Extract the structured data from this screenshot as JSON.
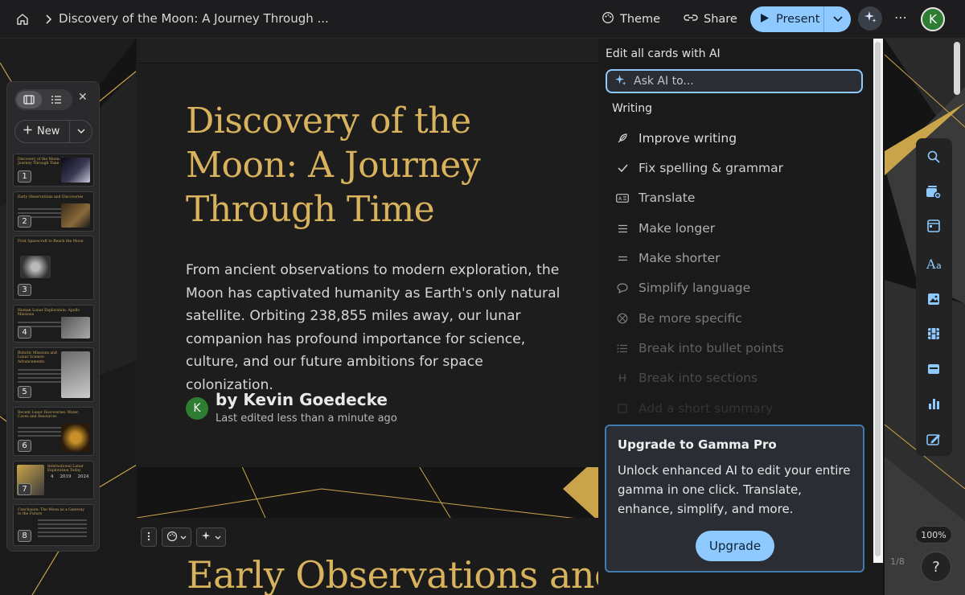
{
  "topbar": {
    "title": "Discovery of the Moon: A Journey Through ...",
    "theme_label": "Theme",
    "share_label": "Share",
    "present_label": "Present",
    "avatar_letter": "K",
    "more_label": "⋯"
  },
  "slides_panel": {
    "new_label": "New",
    "close_label": "✕",
    "slides": [
      {
        "num": "1",
        "title": "Discovery of the Moon: A Journey Through Time"
      },
      {
        "num": "2",
        "title": "Early Observations and Discoveries"
      },
      {
        "num": "3",
        "title": "First Spacecraft to Reach the Moon"
      },
      {
        "num": "4",
        "title": "Human Lunar Exploration: Apollo Missions"
      },
      {
        "num": "5",
        "title": "Robotic Missions and Lunar Science Advancements"
      },
      {
        "num": "6",
        "title": "Recent Lunar Discoveries: Water, Caves and Resources"
      },
      {
        "num": "7",
        "title": "International Lunar Exploration Today"
      },
      {
        "num": "8",
        "title": "Conclusion: The Moon as a Gateway to the Future"
      }
    ],
    "slide7_stats": [
      "4",
      "2019",
      "2024"
    ]
  },
  "card": {
    "title": "Discovery of the Moon: A Journey Through Time",
    "body": "From ancient observations to modern exploration, the Moon has captivated humanity as Earth's only natural satellite. Orbiting 238,855 miles away, our lunar companion has profound importance for science, culture, and our future ambitions for space colonization.",
    "author_letter": "K",
    "author": "by Kevin Goedecke",
    "edited": "Last edited less than a minute ago"
  },
  "card2": {
    "title": "Early Observations and Discoveries"
  },
  "ai_panel": {
    "heading": "Edit all cards with AI",
    "ask_placeholder": "Ask AI to...",
    "section": "Writing",
    "items": [
      {
        "label": "Improve writing",
        "icon": "feather-icon"
      },
      {
        "label": "Fix spelling & grammar",
        "icon": "check-icon"
      },
      {
        "label": "Translate",
        "icon": "translate-icon"
      },
      {
        "label": "Make longer",
        "icon": "lines-icon"
      },
      {
        "label": "Make shorter",
        "icon": "short-lines-icon"
      },
      {
        "label": "Simplify language",
        "icon": "speech-bubble-icon"
      },
      {
        "label": "Be more specific",
        "icon": "target-icon"
      },
      {
        "label": "Break into bullet points",
        "icon": "bullet-list-icon"
      },
      {
        "label": "Break into sections",
        "icon": "sections-icon"
      },
      {
        "label": "Add a short summary",
        "icon": "summary-icon"
      }
    ]
  },
  "upgrade": {
    "title": "Upgrade to Gamma Pro",
    "text": "Unlock enhanced AI to edit your entire gamma in one click. Translate, enhance, simplify, and more.",
    "button": "Upgrade"
  },
  "footer": {
    "zoom": "100%",
    "pager": "1/8",
    "help": "?"
  },
  "colors": {
    "accent": "#8ec9ff",
    "gold": "#d8b25c",
    "avatar_green": "#2f7d32"
  }
}
